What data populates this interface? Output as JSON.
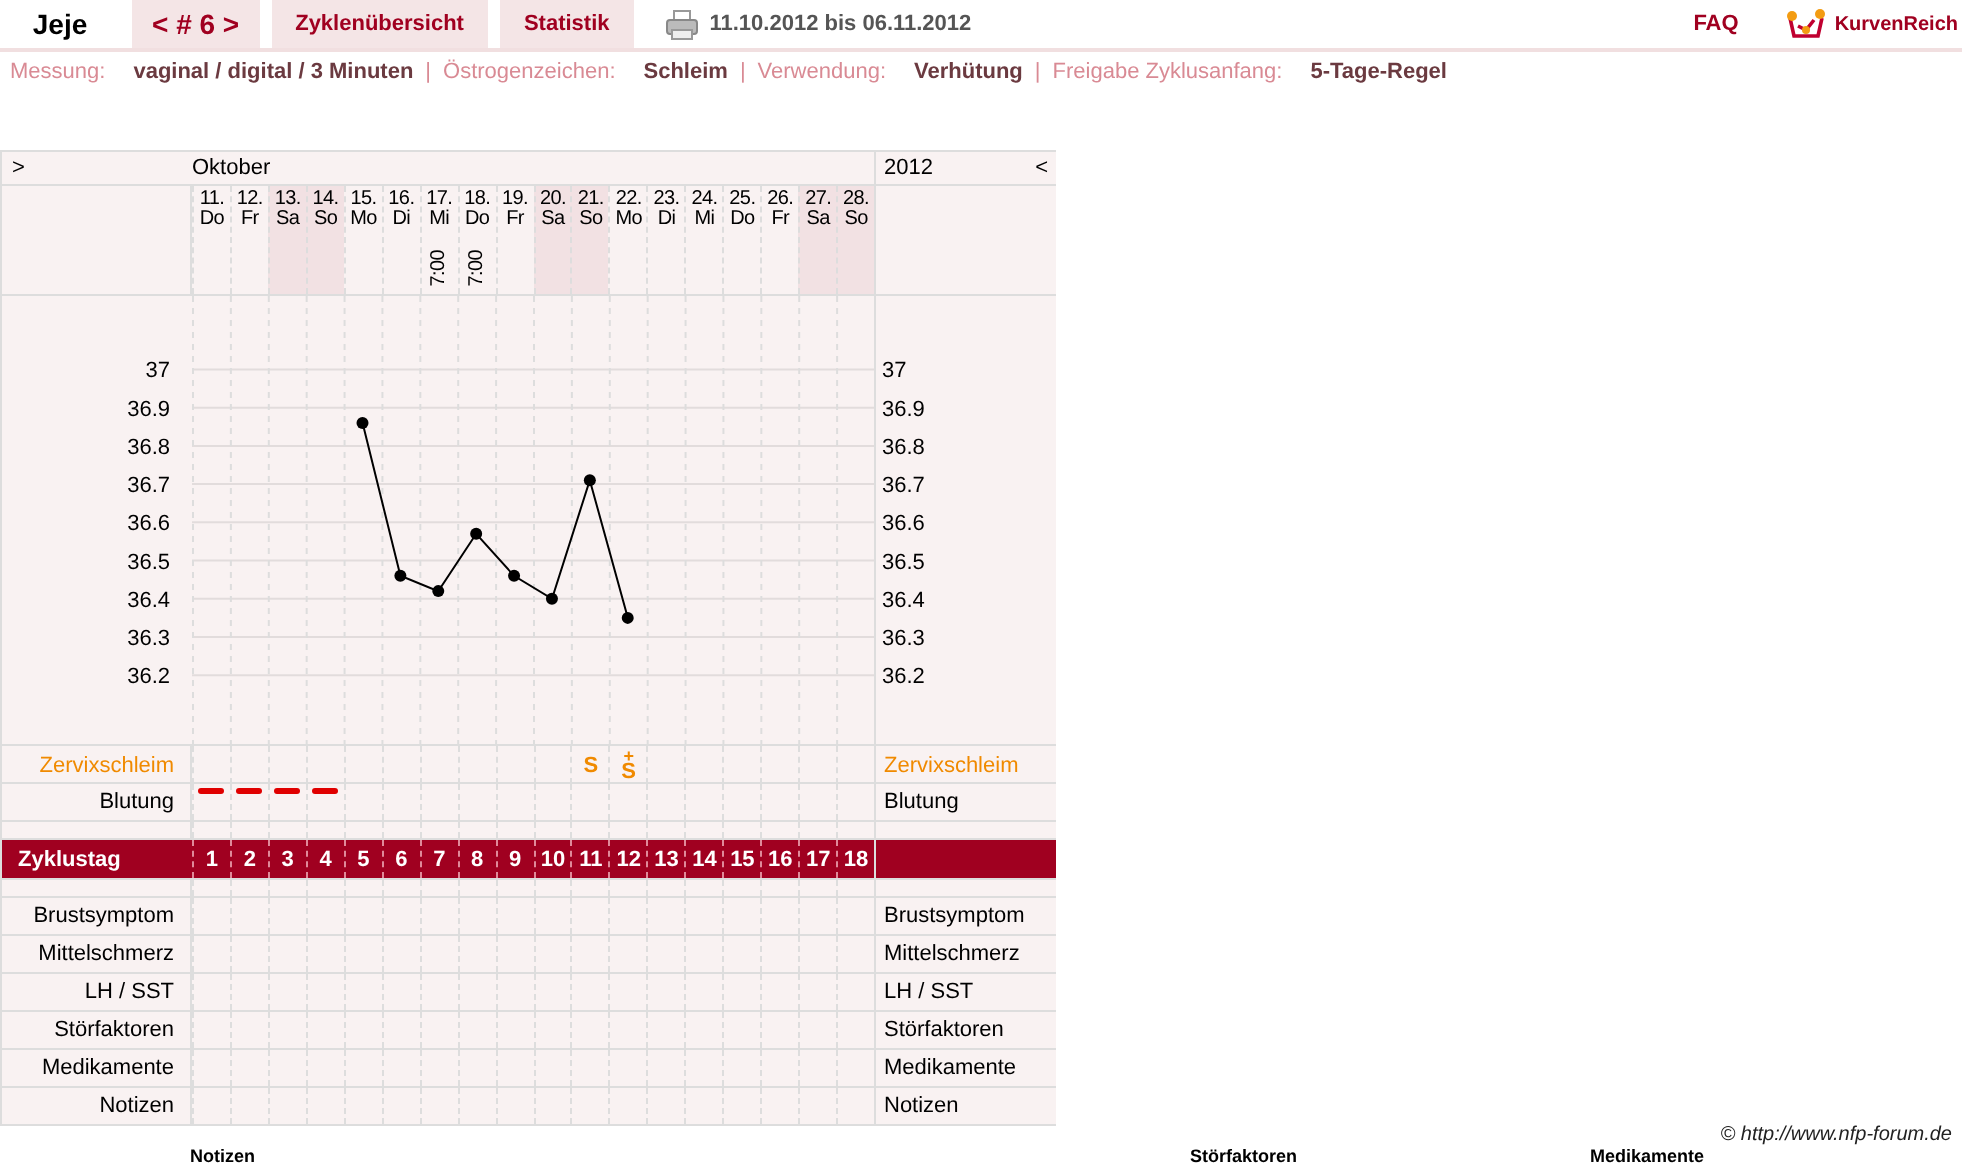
{
  "header": {
    "user": "Jeje",
    "cycle_nav": "< # 6 >",
    "tabs": [
      {
        "label": "Zyklenübersicht",
        "selected": false
      },
      {
        "label": "Statistik",
        "selected": false
      }
    ],
    "date_range": "11.10.2012 bis 06.11.2012",
    "faq": "FAQ",
    "logo": "KurvenReich"
  },
  "info": [
    {
      "label": "Messung:",
      "value": "vaginal / digital / 3 Minuten"
    },
    {
      "separator": "|",
      "label": "Östrogenzeichen:",
      "value": "Schleim"
    },
    {
      "separator": "|",
      "label": "Verwendung:",
      "value": "Verhütung"
    },
    {
      "separator": "|",
      "label": "Freigabe Zyklusanfang:",
      "value": "5-Tage-Regel"
    }
  ],
  "calendar": {
    "prev": ">",
    "month": "Oktober",
    "year": "2012",
    "next": "<",
    "days": [
      {
        "date": "11.",
        "weekday": "Do",
        "weekend": false,
        "bleeding": true,
        "cycle_day": "1"
      },
      {
        "date": "12.",
        "weekday": "Fr",
        "weekend": false,
        "bleeding": true,
        "cycle_day": "2"
      },
      {
        "date": "13.",
        "weekday": "Sa",
        "weekend": true,
        "bleeding": true,
        "cycle_day": "3"
      },
      {
        "date": "14.",
        "weekday": "So",
        "weekend": true,
        "bleeding": true,
        "cycle_day": "4"
      },
      {
        "date": "15.",
        "weekday": "Mo",
        "weekend": false,
        "bleeding": false,
        "cycle_day": "5"
      },
      {
        "date": "16.",
        "weekday": "Di",
        "weekend": false,
        "bleeding": false,
        "cycle_day": "6"
      },
      {
        "date": "17.",
        "weekday": "Mi",
        "weekend": false,
        "bleeding": false,
        "cycle_day": "7",
        "time": "7:00"
      },
      {
        "date": "18.",
        "weekday": "Do",
        "weekend": false,
        "bleeding": false,
        "cycle_day": "8",
        "time": "7:00"
      },
      {
        "date": "19.",
        "weekday": "Fr",
        "weekend": false,
        "bleeding": false,
        "cycle_day": "9"
      },
      {
        "date": "20.",
        "weekday": "Sa",
        "weekend": true,
        "bleeding": false,
        "cycle_day": "10"
      },
      {
        "date": "21.",
        "weekday": "So",
        "weekend": true,
        "bleeding": false,
        "cycle_day": "11",
        "cervix": {
          "symbol": "S"
        }
      },
      {
        "date": "22.",
        "weekday": "Mo",
        "weekend": false,
        "bleeding": false,
        "cycle_day": "12",
        "cervix": {
          "symbol": "S",
          "modifier": "+"
        }
      },
      {
        "date": "23.",
        "weekday": "Di",
        "weekend": false,
        "bleeding": false,
        "cycle_day": "13"
      },
      {
        "date": "24.",
        "weekday": "Mi",
        "weekend": false,
        "bleeding": false,
        "cycle_day": "14"
      },
      {
        "date": "25.",
        "weekday": "Do",
        "weekend": false,
        "bleeding": false,
        "cycle_day": "15"
      },
      {
        "date": "26.",
        "weekday": "Fr",
        "weekend": false,
        "bleeding": false,
        "cycle_day": "16"
      },
      {
        "date": "27.",
        "weekday": "Sa",
        "weekend": true,
        "bleeding": false,
        "cycle_day": "17"
      },
      {
        "date": "28.",
        "weekday": "So",
        "weekend": true,
        "bleeding": false,
        "cycle_day": "18"
      }
    ],
    "chart_data": {
      "type": "line",
      "grid": true,
      "ylim": [
        36.02,
        37.48
      ],
      "yticks": [
        36.2,
        36.3,
        36.4,
        36.5,
        36.6,
        36.7,
        36.8,
        36.9,
        {
          "value": 37,
          "label": "37"
        }
      ],
      "series": [
        {
          "color": "#000000",
          "marker": "circle",
          "values": [
            null,
            null,
            null,
            null,
            36.86,
            36.46,
            36.42,
            36.57,
            36.46,
            36.4,
            36.71,
            36.35,
            null,
            null,
            null,
            null,
            null,
            null
          ]
        }
      ]
    },
    "right_axis_labels": [
      "37",
      "36.9",
      "36.8",
      "36.7",
      "36.6",
      "36.5",
      "36.4",
      "36.3",
      "36.2"
    ],
    "cervix_row": {
      "left": "Zervixschleim",
      "right": "Zervixschleim"
    },
    "bleeding_row": {
      "left": "Blutung",
      "right": "Blutung"
    },
    "cycle_row": {
      "label": "Zyklustag"
    },
    "symptom_rows": [
      {
        "left": "Brustsymptom",
        "right": "Brustsymptom"
      },
      {
        "left": "Mittelschmerz",
        "right": "Mittelschmerz"
      },
      {
        "left": "LH / SST",
        "right": "LH / SST"
      },
      {
        "left": "Störfaktoren",
        "right": "Störfaktoren"
      },
      {
        "left": "Medikamente",
        "right": "Medikamente"
      },
      {
        "left": "Notizen",
        "right": "Notizen"
      }
    ]
  },
  "copyright": "© http://www.nfp-forum.de",
  "footer_headings": [
    "Notizen",
    "Störfaktoren",
    "Medikamente"
  ]
}
